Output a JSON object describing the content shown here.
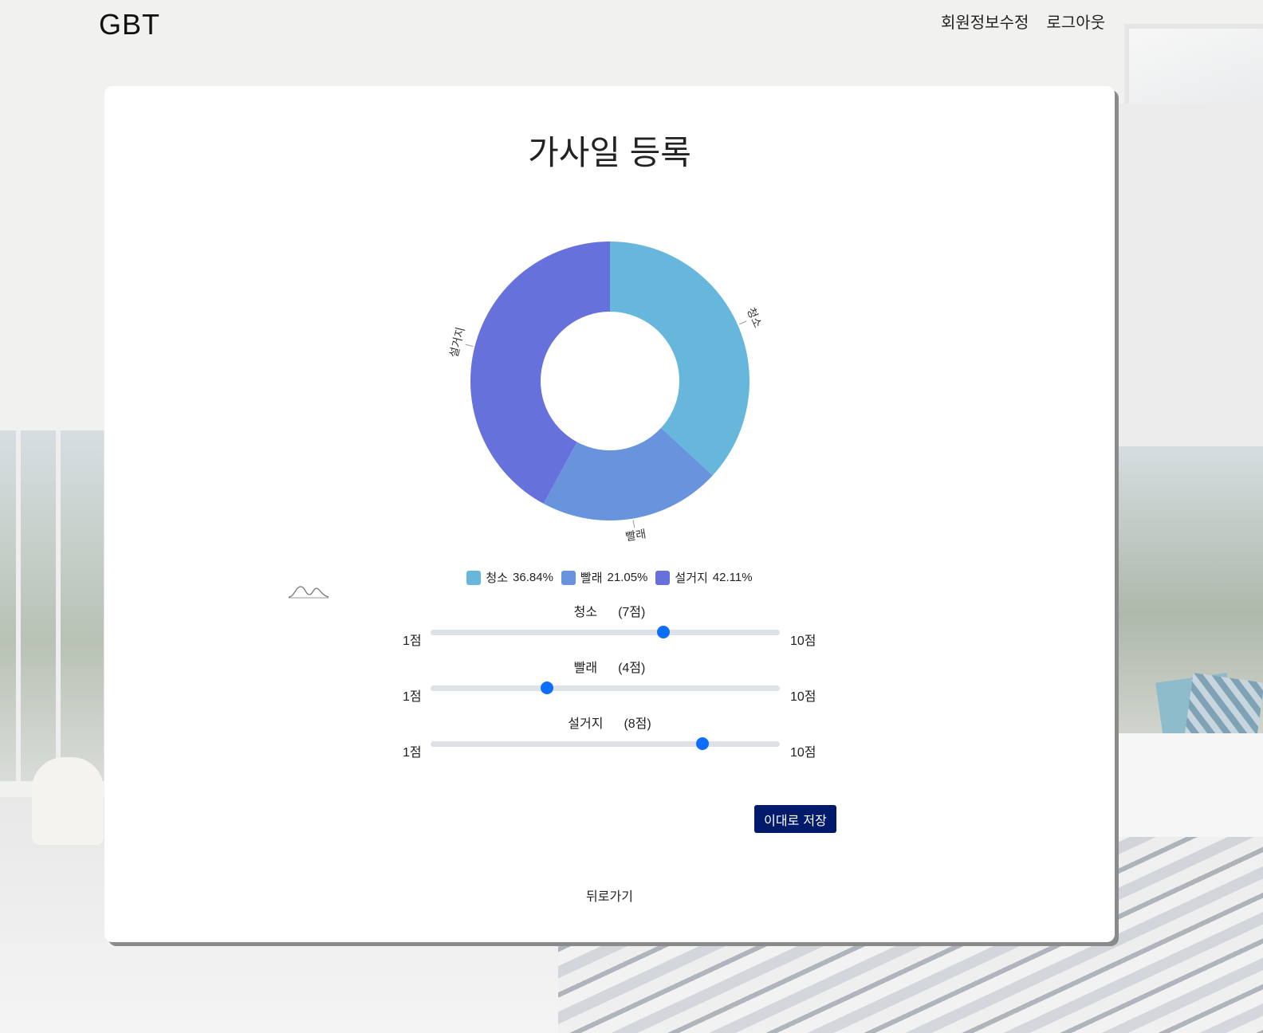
{
  "header": {
    "site_title": "GBT",
    "nav": {
      "edit_profile": "회원정보수정",
      "logout": "로그아웃"
    }
  },
  "page": {
    "title": "가사일 등록"
  },
  "chart_data": {
    "type": "pie",
    "donut": true,
    "categories": [
      "청소",
      "빨래",
      "설거지"
    ],
    "values": [
      7,
      4,
      8
    ],
    "percentages": [
      "36.84%",
      "21.05%",
      "42.11%"
    ],
    "colors": [
      "#67b6dc",
      "#6794dc",
      "#6771dc"
    ],
    "legend": [
      {
        "name": "청소",
        "pct": "36.84%"
      },
      {
        "name": "빨래",
        "pct": "21.05%"
      },
      {
        "name": "설거지",
        "pct": "42.11%"
      }
    ],
    "legend_position": "bottom"
  },
  "sliders": [
    {
      "name": "청소",
      "points_label": "(7점)",
      "value": 7,
      "min": 1,
      "max": 10,
      "min_label": "1점",
      "max_label": "10점"
    },
    {
      "name": "빨래",
      "points_label": "(4점)",
      "value": 4,
      "min": 1,
      "max": 10,
      "min_label": "1점",
      "max_label": "10점"
    },
    {
      "name": "설거지",
      "points_label": "(8점)",
      "value": 8,
      "min": 1,
      "max": 10,
      "min_label": "1점",
      "max_label": "10점"
    }
  ],
  "actions": {
    "save_label": "이대로 저장",
    "back_label": "뒤로가기"
  },
  "colors": {
    "accent": "#0d6efd",
    "save_button": "#011a6b",
    "track": "#dee2e6"
  }
}
